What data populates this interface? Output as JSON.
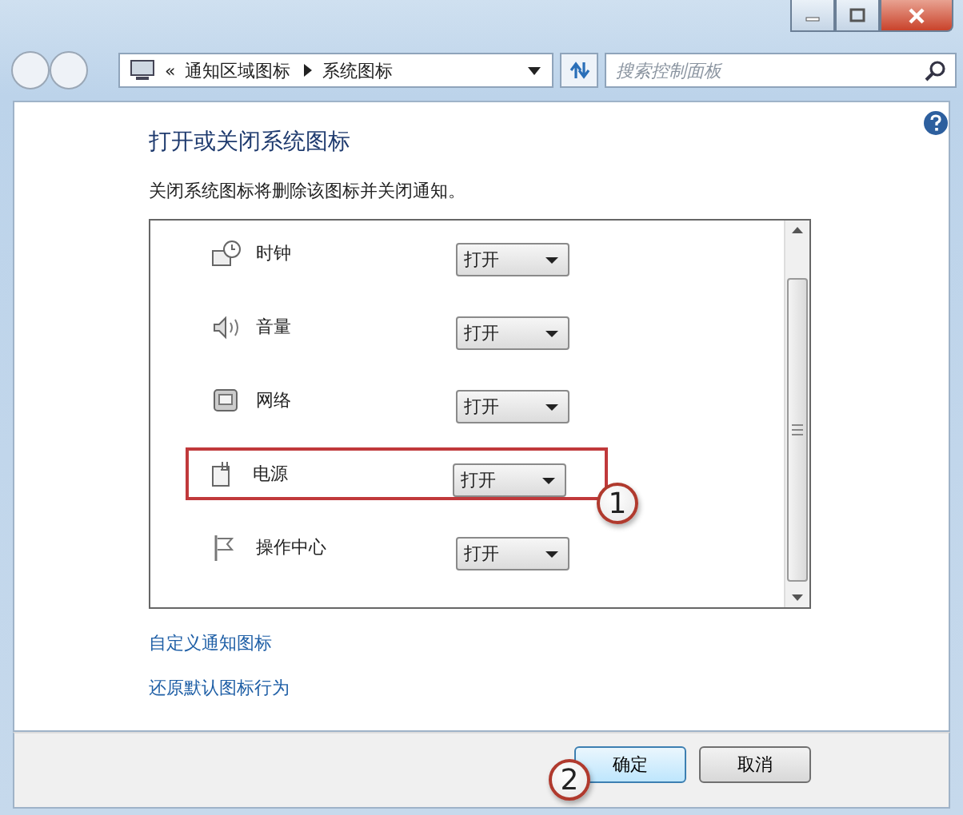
{
  "address_bar": {
    "overflow": "«",
    "path": [
      "通知区域图标",
      "系统图标"
    ]
  },
  "search": {
    "placeholder": "搜索控制面板"
  },
  "title": "打开或关闭系统图标",
  "description": "关闭系统图标将删除该图标并关闭通知。",
  "rows": [
    {
      "label": "时钟",
      "value": "打开",
      "highlighted": false
    },
    {
      "label": "音量",
      "value": "打开",
      "highlighted": false
    },
    {
      "label": "网络",
      "value": "打开",
      "highlighted": false
    },
    {
      "label": "电源",
      "value": "打开",
      "highlighted": true,
      "callout": "1"
    },
    {
      "label": "操作中心",
      "value": "打开",
      "highlighted": false
    }
  ],
  "links": [
    "自定义通知图标",
    "还原默认图标行为"
  ],
  "buttons": [
    {
      "label": "确定",
      "default": true,
      "callout": "2"
    },
    {
      "label": "取消",
      "default": false
    }
  ]
}
